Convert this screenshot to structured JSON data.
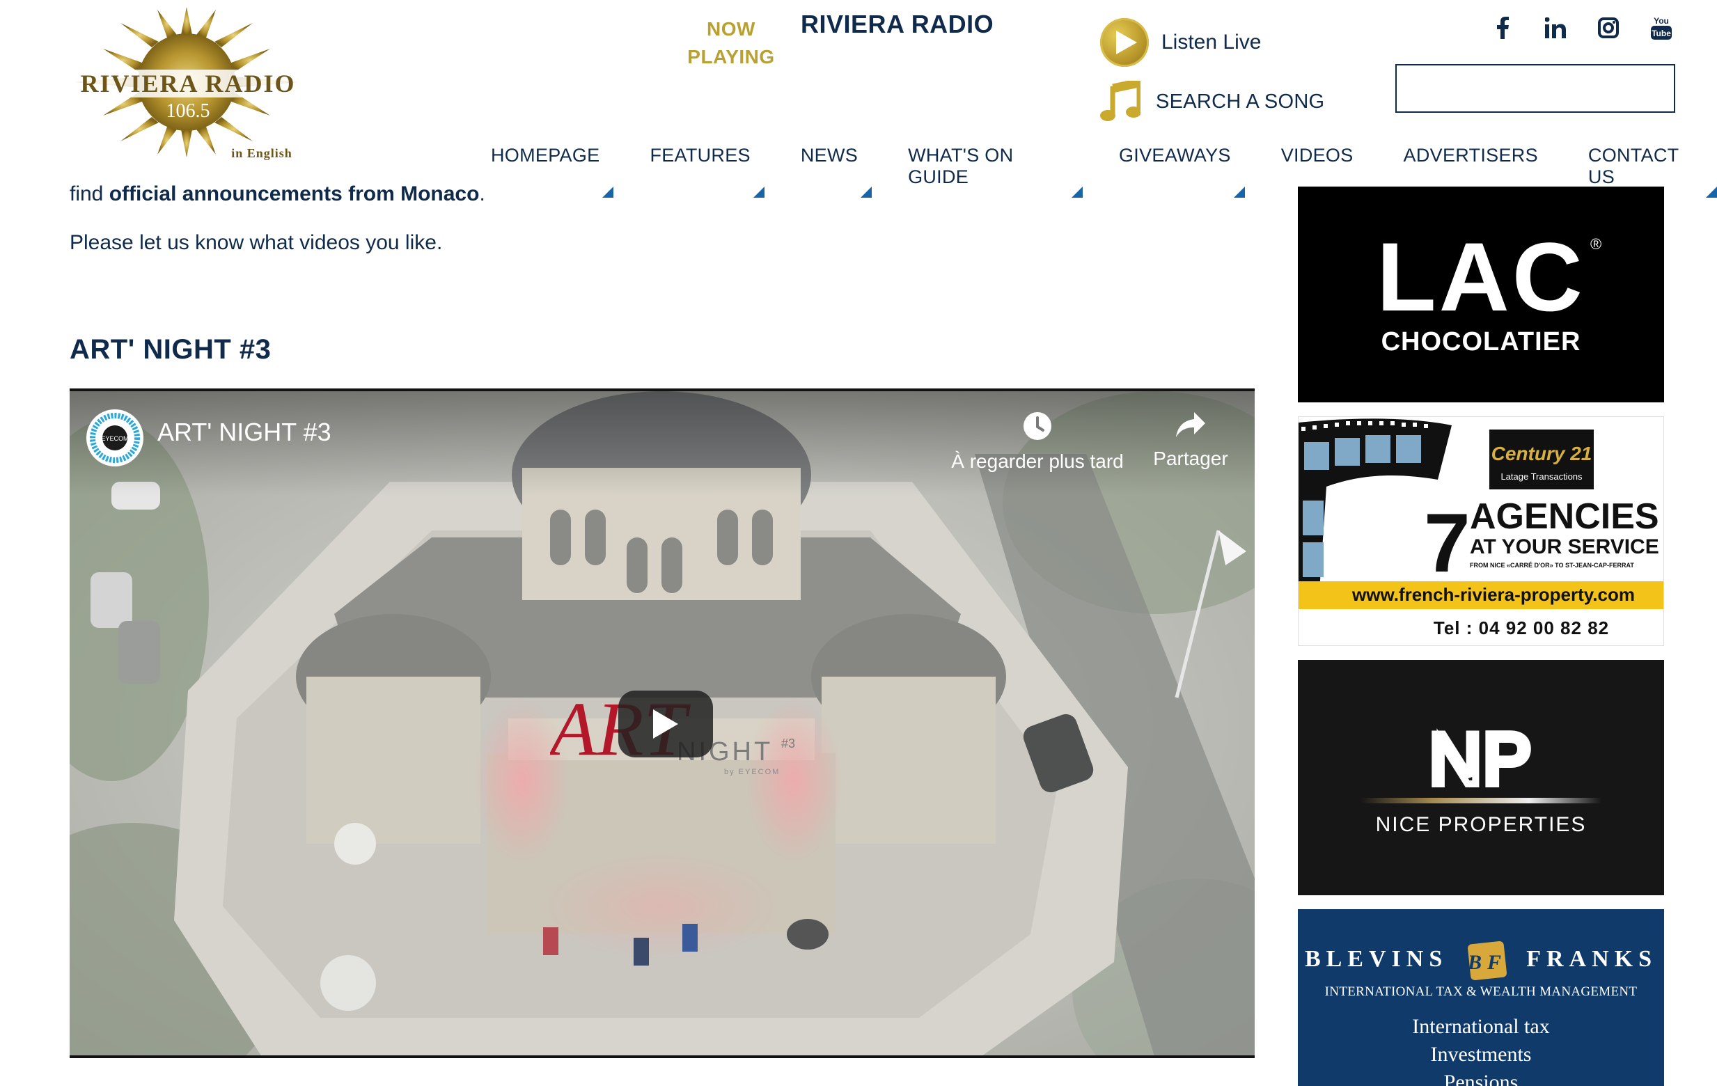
{
  "header": {
    "logo": {
      "name": "RIVIERA RADIO",
      "frequency": "106.5",
      "tagline": "in English"
    },
    "now_playing_label": "NOW PLAYING",
    "station_name": "RIVIERA RADIO",
    "listen_live_label": "Listen Live",
    "search_song_label": "SEARCH A SONG",
    "search_input": {
      "value": "",
      "placeholder": ""
    },
    "social": [
      "facebook-icon",
      "linkedin-icon",
      "instagram-icon",
      "youtube-icon"
    ]
  },
  "nav": {
    "items": [
      {
        "label": "HOMEPAGE"
      },
      {
        "label": "FEATURES"
      },
      {
        "label": "NEWS"
      },
      {
        "label": "WHAT'S ON GUIDE"
      },
      {
        "label": "GIVEAWAYS"
      },
      {
        "label": "VIDEOS"
      },
      {
        "label": "ADVERTISERS"
      },
      {
        "label": "CONTACT US"
      }
    ]
  },
  "content": {
    "intro_prefix": "find ",
    "intro_bold": "official announcements from Monaco",
    "intro_suffix": ".",
    "request": "Please let us know what videos you like.",
    "section_title": "ART' NIGHT #3"
  },
  "video": {
    "title": "ART' NIGHT #3",
    "channel_logo_text": "EYECOM",
    "watch_later_label": "À regarder plus tard",
    "share_label": "Partager",
    "overlay_logo": {
      "art": "ART",
      "night": "NIGHT",
      "num": "#3",
      "by": "by EYECOM"
    }
  },
  "ads": {
    "lac": {
      "big": "LAC",
      "reg": "®",
      "small": "CHOCOLATIER"
    },
    "century21": {
      "brand": "Century 21",
      "sub": "Latage Transactions",
      "number": "7",
      "line1": "AGENCIES",
      "line2": "AT YOUR SERVICE",
      "line3": "FROM NICE «CARRÉ D'OR» TO ST-JEAN-CAP-FERRAT",
      "url": "www.french-riviera-property.com",
      "tel": "Tel : 04 92 00 82 82"
    },
    "nice_properties": {
      "mark": "NP",
      "text": "NICE PROPERTIES"
    },
    "blevins": {
      "brand_left": "BLEVINS",
      "brand_right": "FRANKS",
      "sub": "INTERNATIONAL TAX & WEALTH MANAGEMENT",
      "line1": "International tax",
      "line2": "Investments",
      "line3": "Pensions"
    }
  },
  "colors": {
    "navy": "#0f2a4a",
    "gold": "#b8a033",
    "nav_triangle": "#1565a8",
    "c21_yellow": "#f3c31a"
  }
}
